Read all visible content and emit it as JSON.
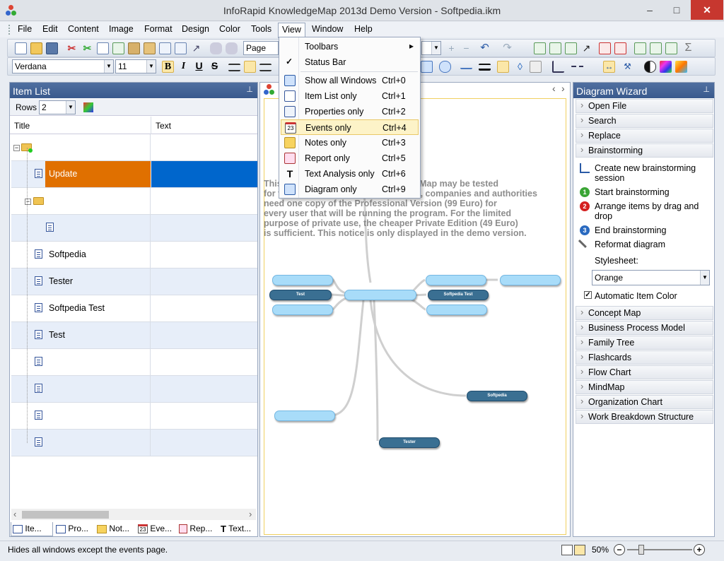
{
  "window": {
    "title": "InfoRapid KnowledgeMap 2013d Demo Version - Softpedia.ikm",
    "minimize": "–",
    "maximize": "□",
    "close": "✕"
  },
  "menu": [
    "File",
    "Edit",
    "Content",
    "Image",
    "Format",
    "Design",
    "Color",
    "Tools",
    "View",
    "Window",
    "Help"
  ],
  "toolbar": {
    "style_value": "Page",
    "font_value": "Verdana",
    "size_value": "11",
    "bold": "B",
    "italic": "I",
    "underline": "U",
    "strike": "S",
    "sum": "Σ"
  },
  "view_menu": [
    {
      "label": "Toolbars",
      "shortcut": "",
      "arrow": "▸"
    },
    {
      "label": "Status Bar",
      "shortcut": "",
      "check": "✓"
    },
    {
      "label": "Show all Windows",
      "shortcut": "Ctrl+0"
    },
    {
      "label": "Item List only",
      "shortcut": "Ctrl+1"
    },
    {
      "label": "Properties only",
      "shortcut": "Ctrl+2"
    },
    {
      "label": "Events only",
      "shortcut": "Ctrl+4",
      "icon_text": "23"
    },
    {
      "label": "Notes only",
      "shortcut": "Ctrl+3"
    },
    {
      "label": "Report only",
      "shortcut": "Ctrl+5"
    },
    {
      "label": "Text Analysis only",
      "shortcut": "Ctrl+6",
      "icon_text": "T"
    },
    {
      "label": "Diagram only",
      "shortcut": "Ctrl+9"
    }
  ],
  "item_list": {
    "title": "Item List",
    "pin": "⊥",
    "rows_label": "Rows",
    "rows_value": "2",
    "columns": [
      "Title",
      "Text"
    ],
    "rows": [
      "",
      "Update",
      "",
      "",
      "Softpedia",
      "Tester",
      "Softpedia Test",
      "Test",
      "",
      "",
      "",
      ""
    ],
    "tabs": [
      "Ite...",
      "Pro...",
      "Not...",
      "Eve...",
      "Rep...",
      "Text..."
    ],
    "calendar_num": "23",
    "tab_text_icon": "T",
    "scroll_left": "‹",
    "scroll_right": "›"
  },
  "diagram": {
    "nav_left": "‹",
    "nav_right": "›",
    "notice": "This version of InfoRapid KnowledgeMap may be tested\nfor free. For professional use, boards, companies and authorities\nneed one copy of the Professional Version (99 Euro) for\nevery user that will be running the program. For the limited\npurpose of private use, the cheaper Private Edition (49 Euro)\nis sufficient. This notice is only displayed in the demo version.",
    "nodes": [
      "Test",
      "Softpedia Test",
      "Softpedia",
      "Tester"
    ]
  },
  "wizard": {
    "title": "Diagram Wizard",
    "pin": "⊥",
    "sections_top": [
      "Open File",
      "Search",
      "Replace",
      "Brainstorming"
    ],
    "items": [
      "Create new brainstorming session",
      "Start brainstorming",
      "Arrange items by drag and drop",
      "End brainstorming",
      "Reformat diagram"
    ],
    "item_nums": [
      "1",
      "2",
      "3"
    ],
    "stylesheet_label": "Stylesheet:",
    "stylesheet_value": "Orange",
    "auto_color_label": "Automatic Item Color",
    "auto_color_check": "✓",
    "sections_bottom": [
      "Concept Map",
      "Business Process Model",
      "Family Tree",
      "Flashcards",
      "Flow Chart",
      "MindMap",
      "Organization Chart",
      "Work Breakdown Structure"
    ]
  },
  "status": {
    "text": "Hides all windows except the events page.",
    "zoom": "50%",
    "zoom_minus": "−",
    "zoom_plus": "+"
  },
  "colors": {
    "accent": "#3a5a8d",
    "selection": "#e07000",
    "selection_text": "#0066cc",
    "node_light": "#a8dcf9",
    "node_dark": "#3a6f92"
  }
}
